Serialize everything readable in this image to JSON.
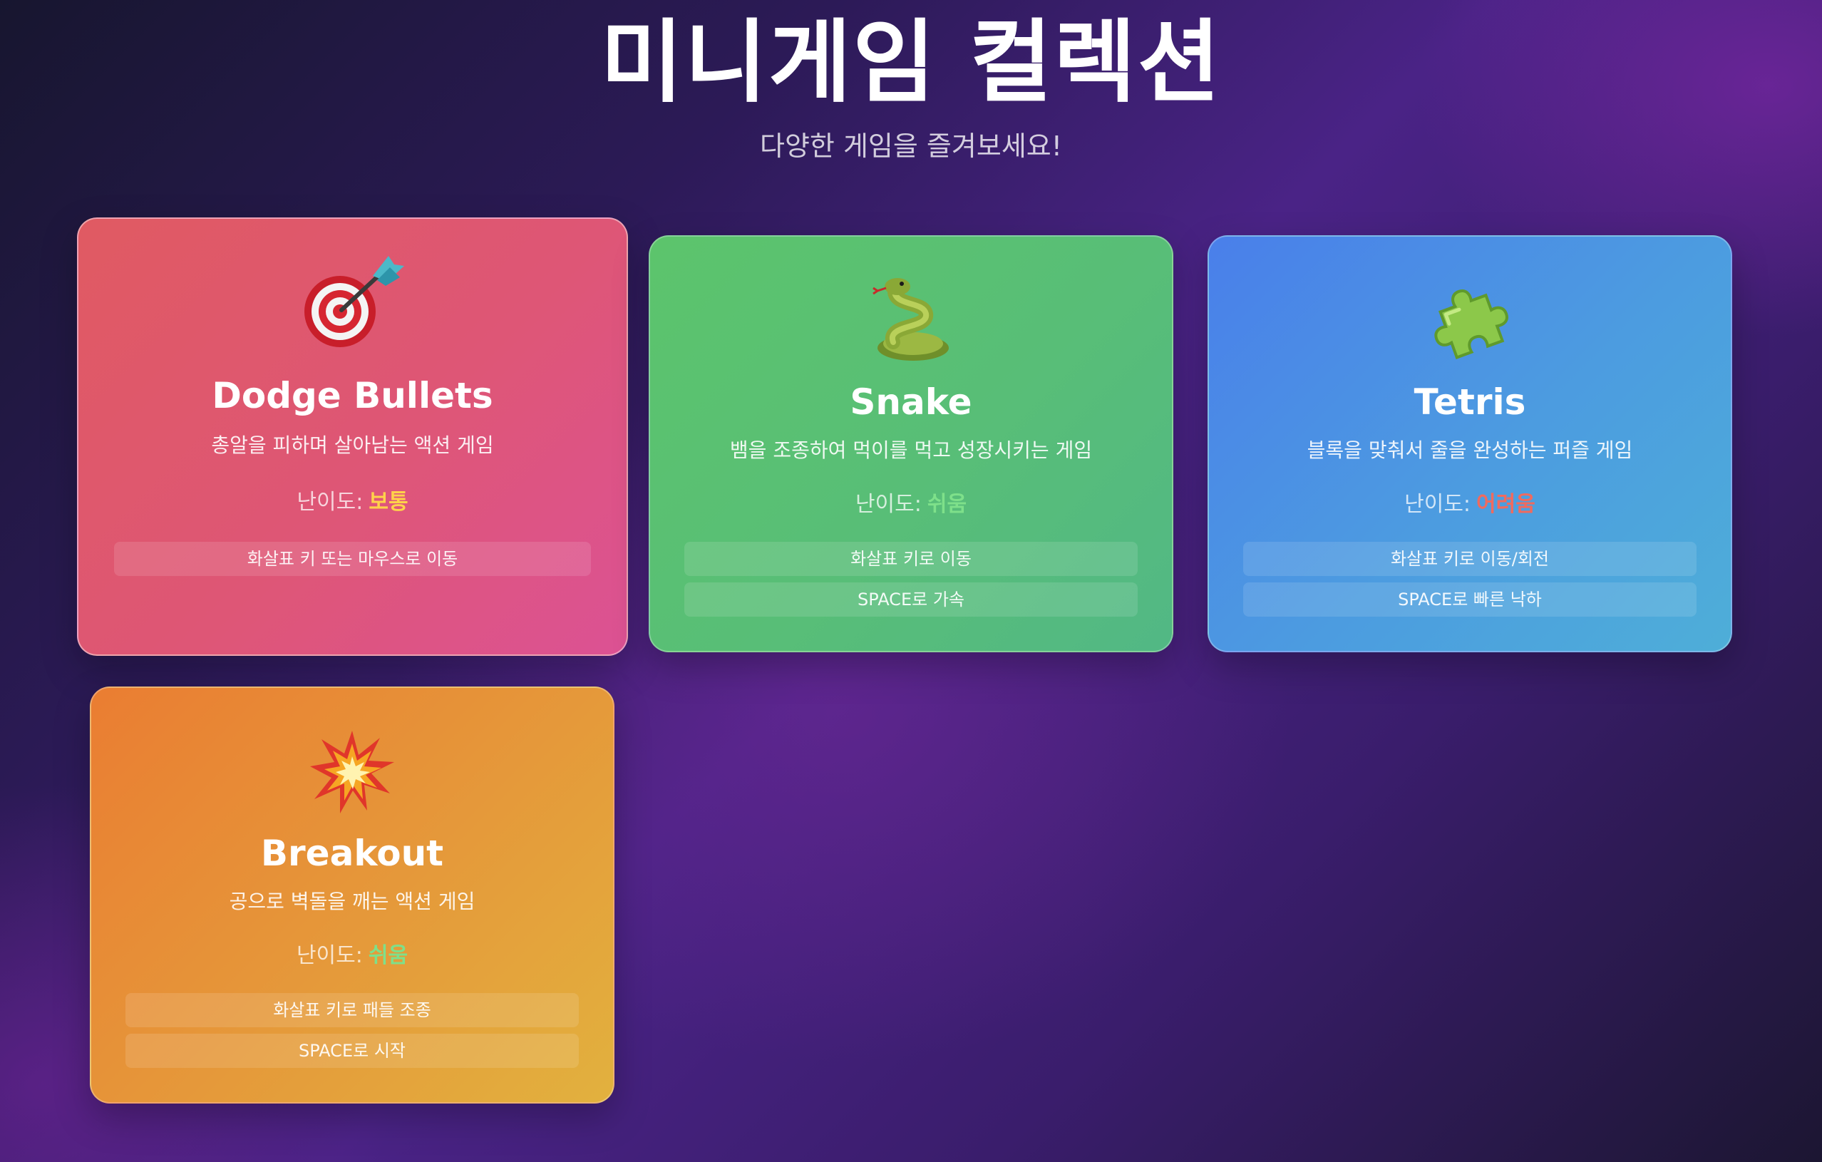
{
  "header": {
    "title": "미니게임 컬렉션",
    "subtitle": "다양한 게임을 즐겨보세요!"
  },
  "games": [
    {
      "id": "dodge",
      "icon": "dart-target-icon",
      "name": "Dodge Bullets",
      "description": "총알을 피하며 살아남는 액션 게임",
      "difficulty_label": "난이도:",
      "difficulty": "보통",
      "difficulty_color": "#ffd24a",
      "gradient_start": "#e05a62",
      "gradient_end": "#dc5294",
      "controls": [
        "화살표 키 또는 마우스로 이동"
      ]
    },
    {
      "id": "snake",
      "icon": "snake-icon",
      "name": "Snake",
      "description": "뱀을 조종하여 먹이를 먹고 성장시키는 게임",
      "difficulty_label": "난이도:",
      "difficulty": "쉬움",
      "difficulty_color": "#7ee08a",
      "gradient_start": "#5cc46c",
      "gradient_end": "#52b885",
      "controls": [
        "화살표 키로 이동",
        "SPACE로 가속"
      ]
    },
    {
      "id": "tetris",
      "icon": "puzzle-piece-icon",
      "name": "Tetris",
      "description": "블록을 맞춰서 줄을 완성하는 퍼즐 게임",
      "difficulty_label": "난이도:",
      "difficulty": "어려움",
      "difficulty_color": "#f06a5e",
      "gradient_start": "#4a7fea",
      "gradient_end": "#4eaed8",
      "controls": [
        "화살표 키로 이동/회전",
        "SPACE로 빠른 낙하"
      ]
    },
    {
      "id": "breakout",
      "icon": "explosion-icon",
      "name": "Breakout",
      "description": "공으로 벽돌을 깨는 액션 게임",
      "difficulty_label": "난이도:",
      "difficulty": "쉬움",
      "difficulty_color": "#7ee08a",
      "gradient_start": "#ea7d32",
      "gradient_end": "#e2b13e",
      "controls": [
        "화살표 키로 패들 조종",
        "SPACE로 시작"
      ]
    }
  ]
}
